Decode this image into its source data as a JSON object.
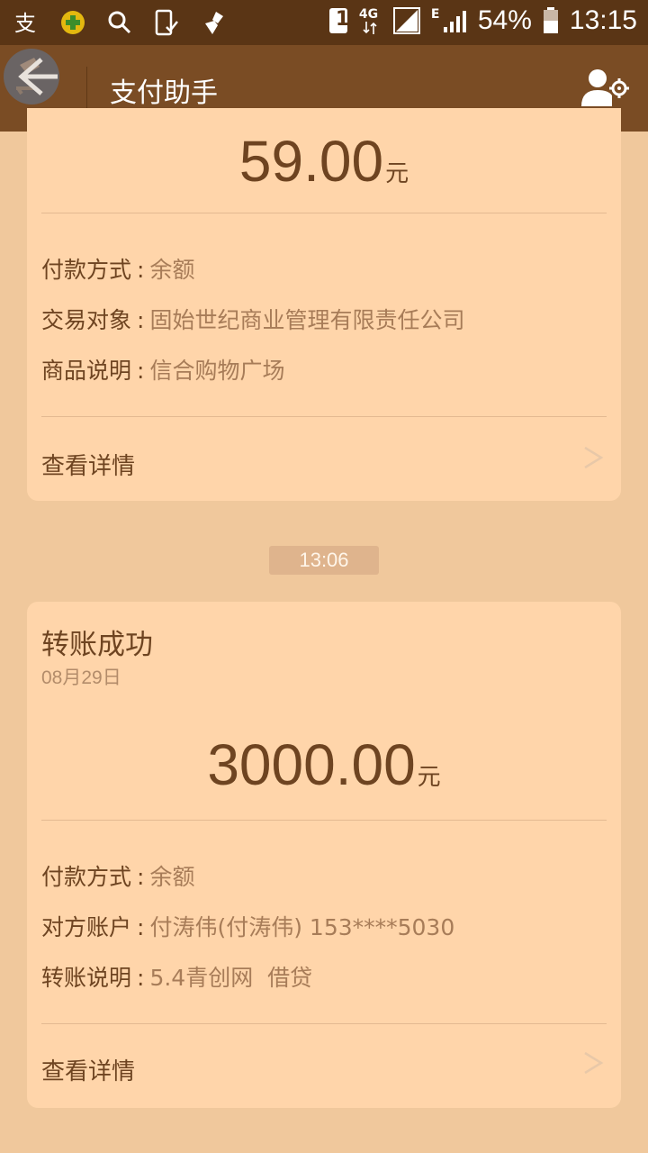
{
  "status_bar": {
    "notification_icons": [
      "alipay-icon",
      "health-plus-icon",
      "search-icon",
      "phone-check-icon",
      "broom-icon"
    ],
    "sim_slot": "1",
    "network": "4G",
    "network_secondary": "E",
    "battery": "54%",
    "time": "13:15"
  },
  "toolbar": {
    "title": "支付助手"
  },
  "cards": [
    {
      "amount": "59.00",
      "unit": "元",
      "rows": [
        {
          "key": "付款方式",
          "value": "余额"
        },
        {
          "key": "交易对象",
          "value": "固始世纪商业管理有限责任公司"
        },
        {
          "key": "商品说明",
          "value": "信合购物广场"
        }
      ],
      "detail_label": "查看详情"
    },
    {
      "title": "转账成功",
      "date": "08月29日",
      "amount": "3000.00",
      "unit": "元",
      "rows": [
        {
          "key": "付款方式",
          "value": "余额"
        },
        {
          "key": "对方账户",
          "value": "付涛伟(付涛伟) 153****5030"
        },
        {
          "key": "转账说明",
          "value": "5.4青创网  借贷"
        }
      ],
      "detail_label": "查看详情"
    }
  ],
  "time_divider": "13:06",
  "colors": {
    "status_bar": "#5a3515",
    "toolbar": "#7a4c24",
    "page_bg": "#f0c89c",
    "card_bg": "#ffd5aa",
    "primary_text": "#6e4421",
    "secondary_text": "#a77c58"
  }
}
